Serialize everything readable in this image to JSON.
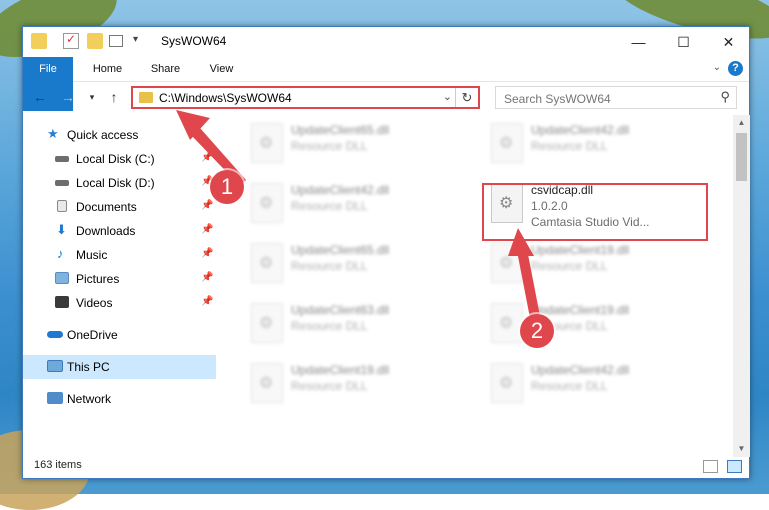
{
  "window": {
    "title": "SysWOW64",
    "minimize_glyph": "—",
    "maximize_glyph": "☐",
    "close_glyph": "✕"
  },
  "ribbon": {
    "tabs": [
      "File",
      "Home",
      "Share",
      "View"
    ],
    "help_label": "?"
  },
  "nav": {
    "address_path": "C:\\Windows\\SysWOW64",
    "search_placeholder": "Search SysWOW64"
  },
  "sidebar": {
    "items": [
      {
        "label": "Quick access",
        "icon": "star-icon"
      },
      {
        "label": "Local Disk (C:)",
        "icon": "drive-icon"
      },
      {
        "label": "Local Disk (D:)",
        "icon": "drive-icon"
      },
      {
        "label": "Documents",
        "icon": "documents-icon"
      },
      {
        "label": "Downloads",
        "icon": "download-icon"
      },
      {
        "label": "Music",
        "icon": "music-icon"
      },
      {
        "label": "Pictures",
        "icon": "pictures-icon"
      },
      {
        "label": "Videos",
        "icon": "videos-icon"
      },
      {
        "label": "OneDrive",
        "icon": "cloud-icon"
      },
      {
        "label": "This PC",
        "icon": "computer-icon"
      },
      {
        "label": "Network",
        "icon": "network-icon"
      }
    ]
  },
  "files": [
    {
      "name": "UpdateClient65.dll",
      "desc": "Resource DLL"
    },
    {
      "name": "UpdateClient42.dll",
      "desc": "Resource DLL"
    },
    {
      "name": "UpdateClient42.dll",
      "desc": "Resource DLL"
    },
    {
      "name": "csvidcap.dll",
      "version": "1.0.2.0",
      "desc": "Camtasia Studio Vid..."
    },
    {
      "name": "UpdateClient65.dll",
      "desc": "Resource DLL"
    },
    {
      "name": "UpdateClient19.dll",
      "desc": "Resource DLL"
    },
    {
      "name": "UpdateClient63.dll",
      "desc": "Resource DLL"
    },
    {
      "name": "UpdateClient19.dll",
      "desc": "Resource DLL"
    },
    {
      "name": "UpdateClient19.dll",
      "desc": "Resource DLL"
    },
    {
      "name": "UpdateClient42.dll",
      "desc": "Resource DLL"
    }
  ],
  "status": {
    "item_count": "163 items"
  },
  "annotations": {
    "marker_1": "1",
    "marker_2": "2",
    "color": "#e0474c"
  }
}
